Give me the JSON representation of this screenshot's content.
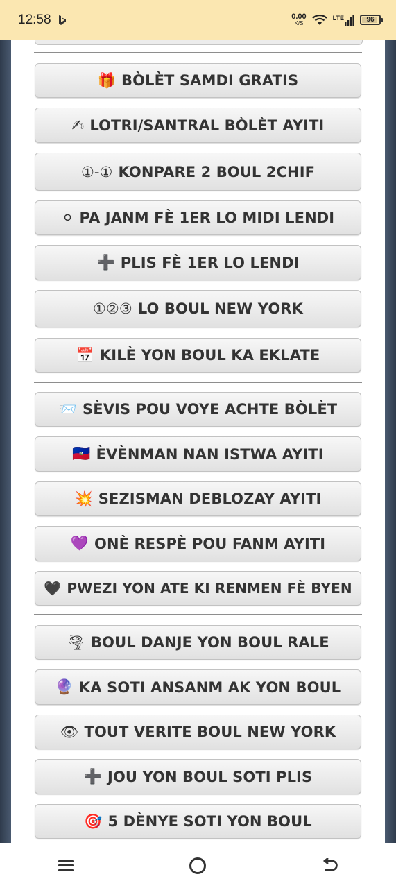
{
  "status_bar": {
    "time": "12:58",
    "app_icon": "bing-icon",
    "speed_value": "0.00",
    "speed_unit": "K/S",
    "network": "LTE",
    "battery": "96"
  },
  "buttons_group_1": [
    {
      "icon": "🎁",
      "label": "BÒLÈT SAMDI GRATIS"
    },
    {
      "icon": "✍",
      "label": "LOTRI/SANTRAL BÒLÈT AYITI"
    },
    {
      "icon": "①-①",
      "label": "KONPARE 2 BOUL 2CHIF"
    },
    {
      "icon": "⚪",
      "label": "PA JANM FÈ 1ER LO MIDI LENDI"
    },
    {
      "icon": "➕",
      "label": "PLIS FÈ 1ER LO LENDI"
    },
    {
      "icon": "①②③",
      "label": "LO BOUL NEW YORK"
    },
    {
      "icon": "📅",
      "label": "KILÈ YON BOUL KA EKLATE"
    }
  ],
  "buttons_group_2": [
    {
      "icon": "📨",
      "label": "SÈVIS POU VOYE ACHTE BÒLÈT"
    },
    {
      "icon": "🇭🇹",
      "label": "ÈVÈNMAN NAN ISTWA AYITI"
    },
    {
      "icon": "💥",
      "label": "SEZISMAN DEBLOZAY AYITI"
    },
    {
      "icon": "💜",
      "label": "ONÈ RESPÈ POU FANM AYITI"
    },
    {
      "icon": "🖤",
      "label": "PWEZI YON ATE KI RENMEN FÈ BYEN"
    }
  ],
  "buttons_group_3": [
    {
      "icon": "🌪",
      "label": "BOUL DANJE YON BOUL RALE"
    },
    {
      "icon": "🔮",
      "label": "KA SOTI ANSANM AK YON BOUL"
    },
    {
      "icon": "👁",
      "label": "TOUT VERITE BOUL NEW YORK"
    },
    {
      "icon": "➕",
      "label": "JOU YON BOUL SOTI PLIS"
    },
    {
      "icon": "🎯",
      "label": "5 DÈNYE SOTI YON BOUL"
    }
  ],
  "nav_bar": {
    "menu": "menu-icon",
    "home": "home-icon",
    "back": "back-icon"
  }
}
